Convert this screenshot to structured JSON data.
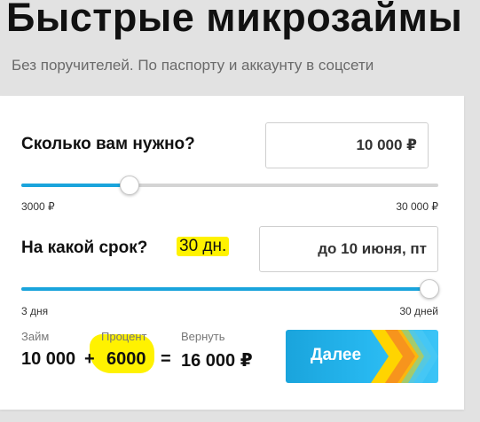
{
  "header": {
    "title": "Быстрые микрозаймы",
    "subtitle": "Без поручителей. По паспорту и аккаунту в соцсети"
  },
  "amount": {
    "question": "Сколько вам нужно?",
    "value": "10 000 ₽",
    "min_label": "3000 ₽",
    "max_label": "30 000 ₽",
    "level": 0.26
  },
  "term": {
    "question": "На какой срок?",
    "highlight": "30 дн.",
    "due_date": "до 10 июня, пт",
    "min_label": "3 дня",
    "max_label": "30 дней",
    "level": 1.0
  },
  "summary": {
    "loan_label": "Займ",
    "loan_value": "10 000",
    "plus": "+",
    "percent_label": "Процент",
    "percent_value": "6000",
    "equals": "=",
    "return_label": "Вернуть",
    "return_value": "16 000 ₽"
  },
  "actions": {
    "next_label": "Далее"
  },
  "colors": {
    "accent": "#1aa4dc",
    "highlight": "#fff200",
    "arrow_yellow": "#ffd400",
    "arrow_orange": "#f7941d"
  }
}
